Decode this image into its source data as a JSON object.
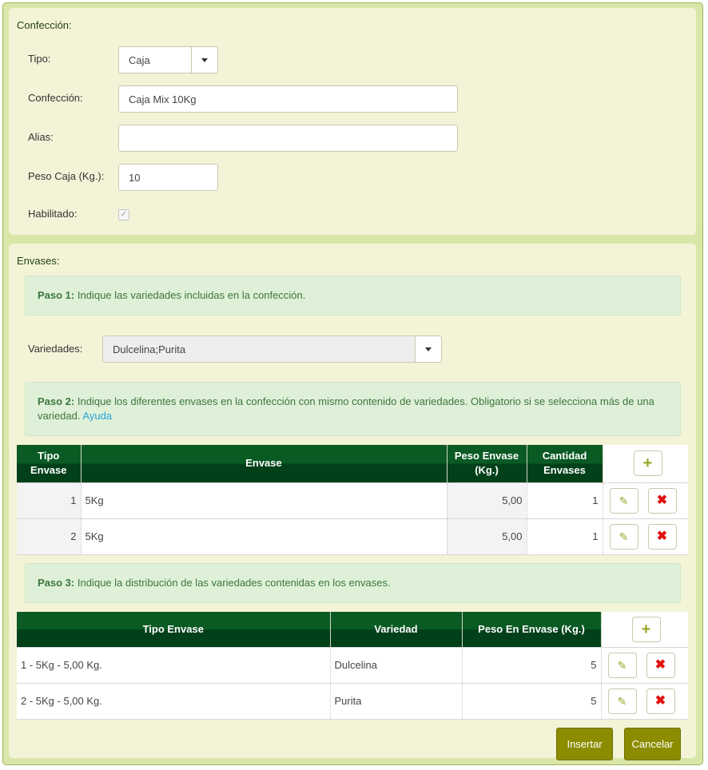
{
  "confeccion_section": {
    "title": "Confección:",
    "tipo_label": "Tipo:",
    "tipo_value": "Caja",
    "confeccion_label": "Confección:",
    "confeccion_value": "Caja Mix 10Kg",
    "alias_label": "Alias:",
    "alias_value": "",
    "peso_label": "Peso Caja (Kg.):",
    "peso_value": "10",
    "habilitado_label": "Habilitado:",
    "habilitado_checked": true
  },
  "envases_section": {
    "title": "Envases:",
    "paso1_strong": "Paso 1:",
    "paso1_text": "Indique las variedades incluidas en la confección.",
    "variedades_label": "Variedades:",
    "variedades_value": "Dulcelina;Purita",
    "paso2_strong": "Paso 2:",
    "paso2_text": "Indique los diferentes envases en la confección con mismo contenido de variedades. Obligatorio si se selecciona más de una variedad.",
    "paso2_link": "Ayuda",
    "paso3_strong": "Paso 3:",
    "paso3_text": "Indique la distribución de las variedades contenidas en los envases."
  },
  "envases_table": {
    "headers": {
      "tipo_envase_1": "Tipo",
      "tipo_envase_2": "Envase",
      "envase": "Envase",
      "peso_envase_1": "Peso Envase",
      "peso_envase_2": "(Kg.)",
      "cantidad_1": "Cantidad",
      "cantidad_2": "Envases"
    },
    "rows": [
      {
        "tipo": "1",
        "envase": "5Kg",
        "peso": "5,00",
        "cantidad": "1"
      },
      {
        "tipo": "2",
        "envase": "5Kg",
        "peso": "5,00",
        "cantidad": "1"
      }
    ]
  },
  "distribucion_table": {
    "headers": {
      "tipo_envase": "Tipo Envase",
      "variedad": "Variedad",
      "peso": "Peso En Envase (Kg.)"
    },
    "rows": [
      {
        "tipo_envase": "1 - 5Kg - 5,00 Kg.",
        "variedad": "Dulcelina",
        "peso": "5"
      },
      {
        "tipo_envase": "2 - 5Kg - 5,00 Kg.",
        "variedad": "Purita",
        "peso": "5"
      }
    ]
  },
  "icons": {
    "add": "+",
    "edit": "✎",
    "delete": "✖",
    "check": "✓"
  },
  "buttons": {
    "insertar": "Insertar",
    "cancelar": "Cancelar"
  },
  "colors": {
    "header_green": "#0a5a24",
    "panel_bg": "#f3f3d8",
    "alert_bg": "#dff0d8",
    "button_olive": "#8c8c00"
  }
}
